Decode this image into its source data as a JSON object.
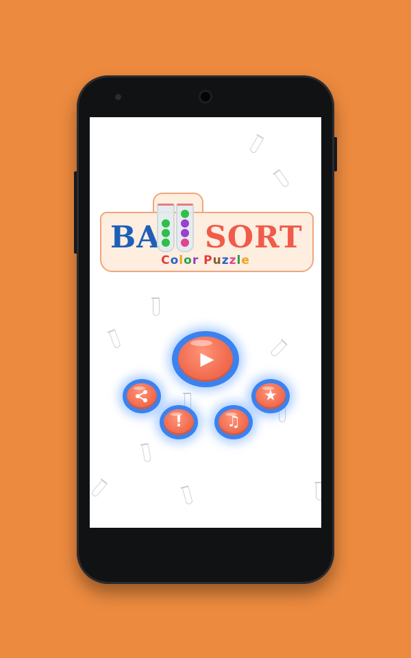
{
  "logo": {
    "word_left": "BA",
    "word_right": "SORT",
    "subtitle_letters": [
      {
        "ch": "C",
        "color": "#e23b3b"
      },
      {
        "ch": "o",
        "color": "#2a63c9"
      },
      {
        "ch": "l",
        "color": "#f0a21c"
      },
      {
        "ch": "o",
        "color": "#2e9d4a"
      },
      {
        "ch": "r",
        "color": "#8a3fc2"
      },
      {
        "ch": " ",
        "color": "#000000"
      },
      {
        "ch": "P",
        "color": "#e23b3b"
      },
      {
        "ch": "u",
        "color": "#8b5a2b"
      },
      {
        "ch": "z",
        "color": "#2a63c9"
      },
      {
        "ch": "z",
        "color": "#e0458f"
      },
      {
        "ch": "l",
        "color": "#2e9d4a"
      },
      {
        "ch": "e",
        "color": "#f0a21c"
      }
    ],
    "tube_left_balls": [
      "#2fbf4a",
      "#2fbf4a",
      "#2fbf4a"
    ],
    "tube_right_balls": [
      "#2fbf4a",
      "#9a3fd0",
      "#9a3fd0",
      "#e0458f"
    ]
  },
  "buttons": {
    "play": {
      "icon": "play-icon",
      "glyph": "▶"
    },
    "share": {
      "icon": "share-icon",
      "glyph": "⋖"
    },
    "info": {
      "icon": "exclamation-icon",
      "glyph": "!"
    },
    "music": {
      "icon": "music-note-icon",
      "glyph": "♫"
    },
    "rate": {
      "icon": "star-icon",
      "glyph": "★"
    }
  },
  "colors": {
    "background": "#ec8a3f",
    "button_ring": "#3b82f0",
    "button_fill": "#f26c4f"
  }
}
